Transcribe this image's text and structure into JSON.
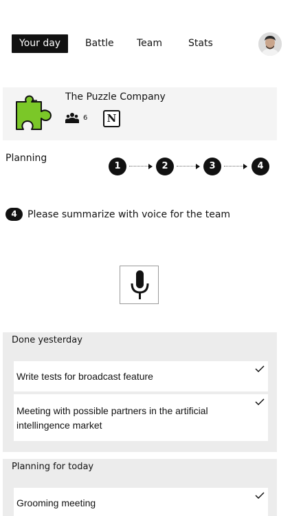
{
  "nav": {
    "tabs": [
      {
        "label": "Your day",
        "active": true
      },
      {
        "label": "Battle",
        "active": false
      },
      {
        "label": "Team",
        "active": false
      },
      {
        "label": "Stats",
        "active": false
      }
    ]
  },
  "company": {
    "name": "The Puzzle Company",
    "members_count": "6",
    "logo_color": "#7bc728",
    "integration_letter": "N"
  },
  "planning": {
    "label": "Planning",
    "steps": [
      "1",
      "2",
      "3",
      "4"
    ]
  },
  "instruction": {
    "step": "4",
    "text": "Please summarize with voice for the team"
  },
  "done_yesterday": {
    "title": "Done yesterday",
    "items": [
      {
        "line1": "Write tests for broadcast feature",
        "line2": "",
        "done": true
      },
      {
        "line1": "Meeting with possible partners in the artificial",
        "line2": "intellingence market",
        "done": true
      }
    ]
  },
  "planning_today": {
    "title": "Planning for today",
    "items": [
      {
        "line1": "Grooming meeting",
        "done": true
      }
    ]
  }
}
